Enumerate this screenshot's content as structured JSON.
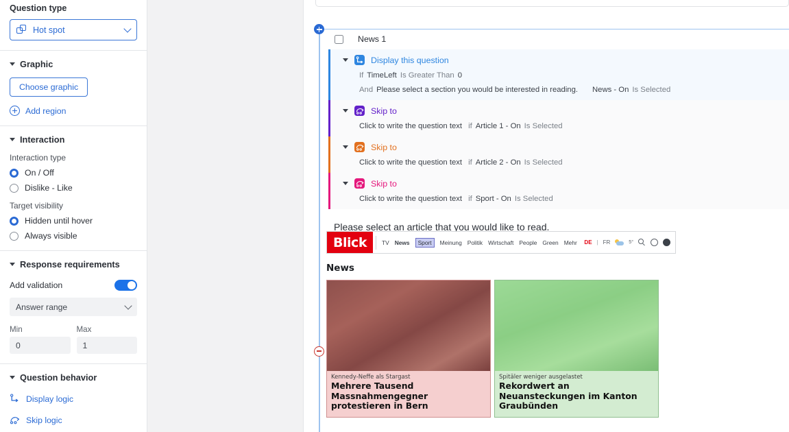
{
  "sidebar": {
    "question_type": {
      "label": "Question type",
      "value": "Hot spot",
      "icon": "overlapping-squares-icon"
    },
    "graphic": {
      "title": "Graphic",
      "choose_button": "Choose graphic",
      "add_region": "Add region"
    },
    "interaction": {
      "title": "Interaction",
      "interaction_type_label": "Interaction type",
      "interaction_options": [
        {
          "label": "On / Off",
          "selected": true
        },
        {
          "label": "Dislike - Like",
          "selected": false
        }
      ],
      "target_visibility_label": "Target visibility",
      "visibility_options": [
        {
          "label": "Hidden until hover",
          "selected": true
        },
        {
          "label": "Always visible",
          "selected": false
        }
      ]
    },
    "response_requirements": {
      "title": "Response requirements",
      "add_validation_label": "Add validation",
      "add_validation_on": true,
      "validation_type": "Answer range",
      "min_label": "Min",
      "min_value": "0",
      "max_label": "Max",
      "max_value": "1"
    },
    "question_behavior": {
      "title": "Question behavior",
      "display_logic": "Display logic",
      "skip_logic": "Skip logic"
    }
  },
  "main": {
    "question_label": "News 1",
    "rules": [
      {
        "name": "Display this question",
        "color": "#2e86e0",
        "bg": "#f4f9fe",
        "icon": "display-logic-icon",
        "conditions": [
          {
            "kw": "If",
            "field": "TimeLeft",
            "op": "Is Greater Than",
            "value": "0"
          },
          {
            "kw": "And",
            "field": "Please select a section you would be interested in reading.",
            "value": "News - On",
            "op": "Is Selected"
          }
        ]
      },
      {
        "name": "Skip to",
        "color": "#6321c9",
        "bg": "#fafafb",
        "icon": "skip-logic-icon",
        "text": "Click to write the question text",
        "kw": "if",
        "value": "Article 1 - On",
        "op": "Is Selected"
      },
      {
        "name": "Skip to",
        "color": "#e2701f",
        "bg": "#fafafb",
        "icon": "skip-logic-icon",
        "text": "Click to write the question text",
        "kw": "if",
        "value": "Article 2 - On",
        "op": "Is Selected"
      },
      {
        "name": "Skip to",
        "color": "#e4187c",
        "bg": "#fafafb",
        "icon": "skip-logic-icon",
        "text": "Click to write the question text",
        "kw": "if",
        "value": "Sport - On",
        "op": "Is Selected"
      }
    ],
    "question_text": "Please select an article that you would like to read.",
    "preview": {
      "logo": "Blick",
      "nav": [
        {
          "label": "TV",
          "style": "normal"
        },
        {
          "label": "News",
          "style": "bold"
        },
        {
          "label": "Sport",
          "style": "selected"
        },
        {
          "label": "Meinung",
          "style": "normal"
        },
        {
          "label": "Politik",
          "style": "normal"
        },
        {
          "label": "Wirtschaft",
          "style": "normal"
        },
        {
          "label": "People",
          "style": "normal"
        },
        {
          "label": "Green",
          "style": "normal"
        },
        {
          "label": "Mehr",
          "style": "normal"
        }
      ],
      "lang_active": "DE",
      "lang_sep": "|",
      "lang_other": "FR",
      "temperature": "5°",
      "section_title": "News",
      "articles": [
        {
          "kicker": "Kennedy-Neffe als Stargast",
          "headline": "Mehrere Tausend Massnahmengegner protestieren in Bern",
          "region_color": "#e23c3c"
        },
        {
          "kicker": "Spitäler weniger ausgelastet",
          "headline": "Rekordwert an Neuansteckungen im Kanton Graubünden",
          "region_color": "#3cc83c"
        }
      ]
    },
    "rail": {
      "add_label": "add-node",
      "remove_label": "remove-node"
    }
  }
}
